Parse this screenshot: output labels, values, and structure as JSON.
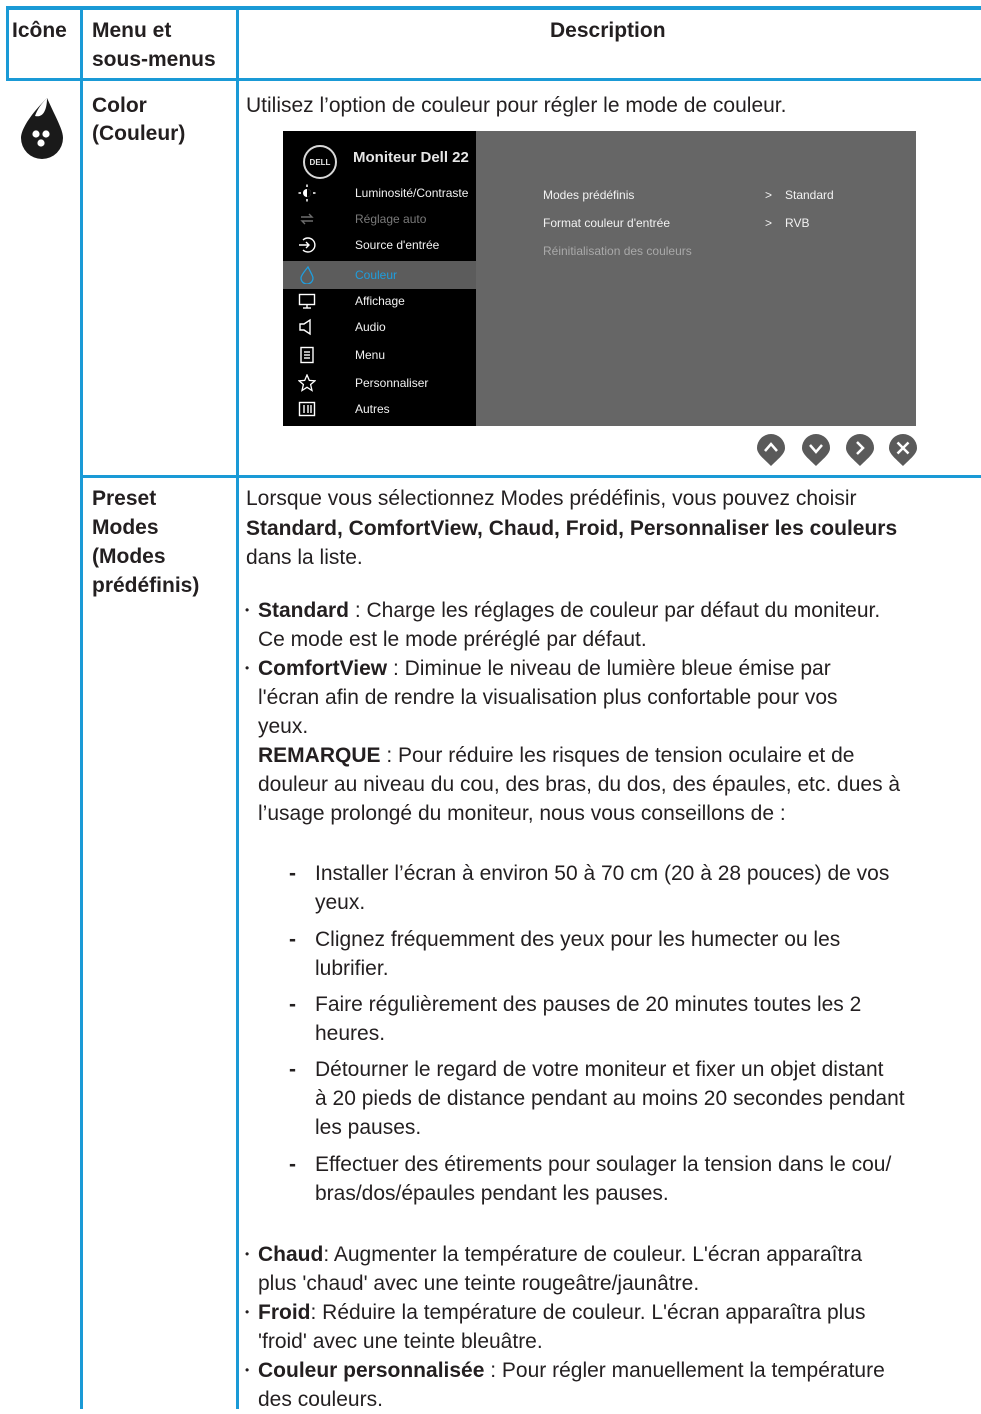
{
  "header": {
    "col_icon": "Icône",
    "col_menu_line1": "Menu et",
    "col_menu_line2": "sous-menus",
    "col_desc": "Description"
  },
  "row_color": {
    "menu_line1": "Color",
    "menu_line2": "(Couleur)",
    "intro": "Utilisez l’option de couleur pour régler le mode de couleur."
  },
  "osd": {
    "logo": "DELL",
    "title": "Moniteur Dell 22",
    "menu": [
      {
        "label": "Luminosité/Contraste",
        "icon": "brightness-icon",
        "state": "normal"
      },
      {
        "label": "Réglage auto",
        "icon": "auto-adjust-icon",
        "state": "dim"
      },
      {
        "label": "Source d'entrée",
        "icon": "input-source-icon",
        "state": "normal"
      },
      {
        "label": "Couleur",
        "icon": "color-icon",
        "state": "active"
      },
      {
        "label": "Affichage",
        "icon": "display-icon",
        "state": "normal"
      },
      {
        "label": "Audio",
        "icon": "audio-icon",
        "state": "normal"
      },
      {
        "label": "Menu",
        "icon": "menu-icon",
        "state": "normal"
      },
      {
        "label": "Personnaliser",
        "icon": "star-icon",
        "state": "normal"
      },
      {
        "label": "Autres",
        "icon": "others-icon",
        "state": "normal"
      }
    ],
    "options": [
      {
        "label": "Modes prédéfinis",
        "arrow": ">",
        "value": "Standard"
      },
      {
        "label": "Format couleur d'entrée",
        "arrow": ">",
        "value": "RVB"
      },
      {
        "label": "Réinitialisation des couleurs",
        "arrow": "",
        "value": ""
      }
    ],
    "buttons": [
      "up-button",
      "down-button",
      "right-button",
      "close-button"
    ],
    "colors": {
      "side": "#000000",
      "panel": "#666666",
      "active_text": "#1f9ede",
      "button": "#5a5a5a"
    }
  },
  "row_preset": {
    "menu_line1": "Preset",
    "menu_line2": "Modes",
    "menu_line3": "(Modes",
    "menu_line4": "prédéfinis)",
    "intro_l1": "Lorsque vous sélectionnez Modes prédéfinis, vous pouvez choisir",
    "intro_l2_bold": "Standard, ComfortView, Chaud, Froid, Personnaliser les couleurs",
    "intro_l3": "dans la liste.",
    "b1_bold": "Standard",
    "b1_l1": " : Charge les réglages de couleur par défaut du moniteur.",
    "b1_l2": "Ce mode est le mode préréglé par défaut.",
    "b2_bold": "ComfortView",
    "b2_l1": " : Diminue le niveau de lumière bleue émise par",
    "b2_l2": "l'écran afin de rendre la visualisation plus confortable pour vos",
    "b2_l3": "yeux.",
    "note_bold": "REMARQUE",
    "note_l1": " : Pour réduire les risques de tension oculaire et de",
    "note_l2": "douleur au niveau du cou, des bras, du dos, des épaules, etc. dues à",
    "note_l3": "l’usage prolongé du moniteur, nous vous conseillons de :",
    "d1_l1": "Installer l’écran à environ 50 à 70 cm (20 à 28 pouces) de vos",
    "d1_l2": "yeux.",
    "d2_l1": "Clignez fréquemment des yeux pour les humecter ou les",
    "d2_l2": "lubrifier.",
    "d3_l1": "Faire régulièrement des pauses de 20 minutes toutes les 2",
    "d3_l2": "heures.",
    "d4_l1": "Détourner le regard de votre moniteur et fixer un objet distant",
    "d4_l2": "à 20 pieds de distance pendant au moins 20 secondes pendant",
    "d4_l3": "les pauses.",
    "d5_l1": "Effectuer des étirements pour soulager la tension dans le cou/",
    "d5_l2": "bras/dos/épaules pendant les pauses.",
    "b3_bold": "Chaud",
    "b3_l1": ": Augmenter la température de couleur. L'écran apparaîtra",
    "b3_l2": "plus 'chaud' avec une teinte rougeâtre/jaunâtre.",
    "b4_bold": "Froid",
    "b4_l1": ": Réduire la température de couleur. L'écran apparaîtra plus",
    "b4_l2": "'froid' avec une teinte bleuâtre.",
    "b5_bold": "Couleur personnalisée",
    "b5_l1": " : Pour régler manuellement la température",
    "b5_l2": "des couleurs.",
    "dash": "-",
    "dot": "•"
  }
}
